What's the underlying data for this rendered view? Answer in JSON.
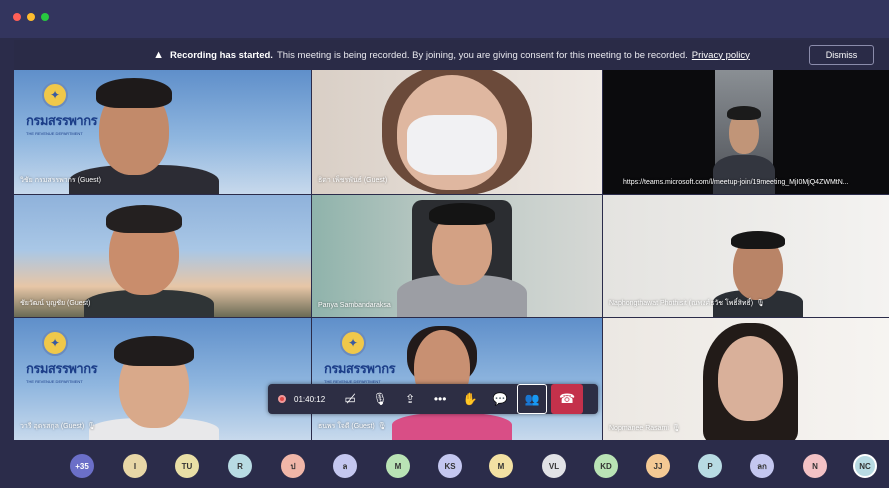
{
  "banner": {
    "title": "Recording has started.",
    "message": "This meeting is being recorded. By joining, you are giving consent for this meeting to be recorded.",
    "link": "Privacy policy",
    "dismiss": "Dismiss"
  },
  "tiles": [
    {
      "name": "วิชัย กรมสรรพากร (Guest)"
    },
    {
      "name": "ธิดา เพ็ชรพันธ์ (Guest)"
    },
    {
      "name": "https://teams.microsoft.com/l/meetup-join/19meeting_MjI0MjQ4ZWMtN..."
    },
    {
      "name": "ชัยวัฒน์ บุญชัย (Guest)"
    },
    {
      "name": "Panya Sambandaraksa"
    },
    {
      "name": "Naphongthawat Phothisit (ณพงศ์ธวัช โพธิ์สิทธิ์)"
    },
    {
      "name": "วารี อุดรสกุล (Guest)"
    },
    {
      "name": "ธนพร ใจดี (Guest)"
    },
    {
      "name": "Nopmanee Rasami"
    }
  ],
  "logo": {
    "emblem": "✦",
    "text": "กรมสรรพากร",
    "sub": "THE REVENUE DEPARTMENT"
  },
  "controls": {
    "timer": "01:40:12",
    "camera_icon": "video-off-icon",
    "mic_icon": "mic-off-icon",
    "share_icon": "share-icon",
    "more_icon": "more-icon",
    "hand_icon": "raise-hand-icon",
    "chat_icon": "chat-icon",
    "people_icon": "people-icon",
    "hangup_icon": "hangup-icon"
  },
  "participants": [
    {
      "initials": "+35",
      "color": "#6b6fc8"
    },
    {
      "initials": "I",
      "color": "#e8d7a7"
    },
    {
      "initials": "TU",
      "color": "#e9dfa6"
    },
    {
      "initials": "R",
      "color": "#b8dbe3"
    },
    {
      "initials": "ป",
      "color": "#f0b6a8"
    },
    {
      "initials": "ล",
      "color": "#c4c7f0"
    },
    {
      "initials": "M",
      "color": "#b9e3b5"
    },
    {
      "initials": "KS",
      "color": "#c4c7f0"
    },
    {
      "initials": "M",
      "color": "#f3e1a3"
    },
    {
      "initials": "VL",
      "color": "#e1e2e6"
    },
    {
      "initials": "KD",
      "color": "#b9e3b5"
    },
    {
      "initials": "JJ",
      "color": "#f4c994"
    },
    {
      "initials": "P",
      "color": "#b8dbe3"
    },
    {
      "initials": "ลก",
      "color": "#c4c7f0"
    },
    {
      "initials": "N",
      "color": "#f3c2c5"
    },
    {
      "initials": "NC",
      "color": "#b8dbe3"
    }
  ]
}
